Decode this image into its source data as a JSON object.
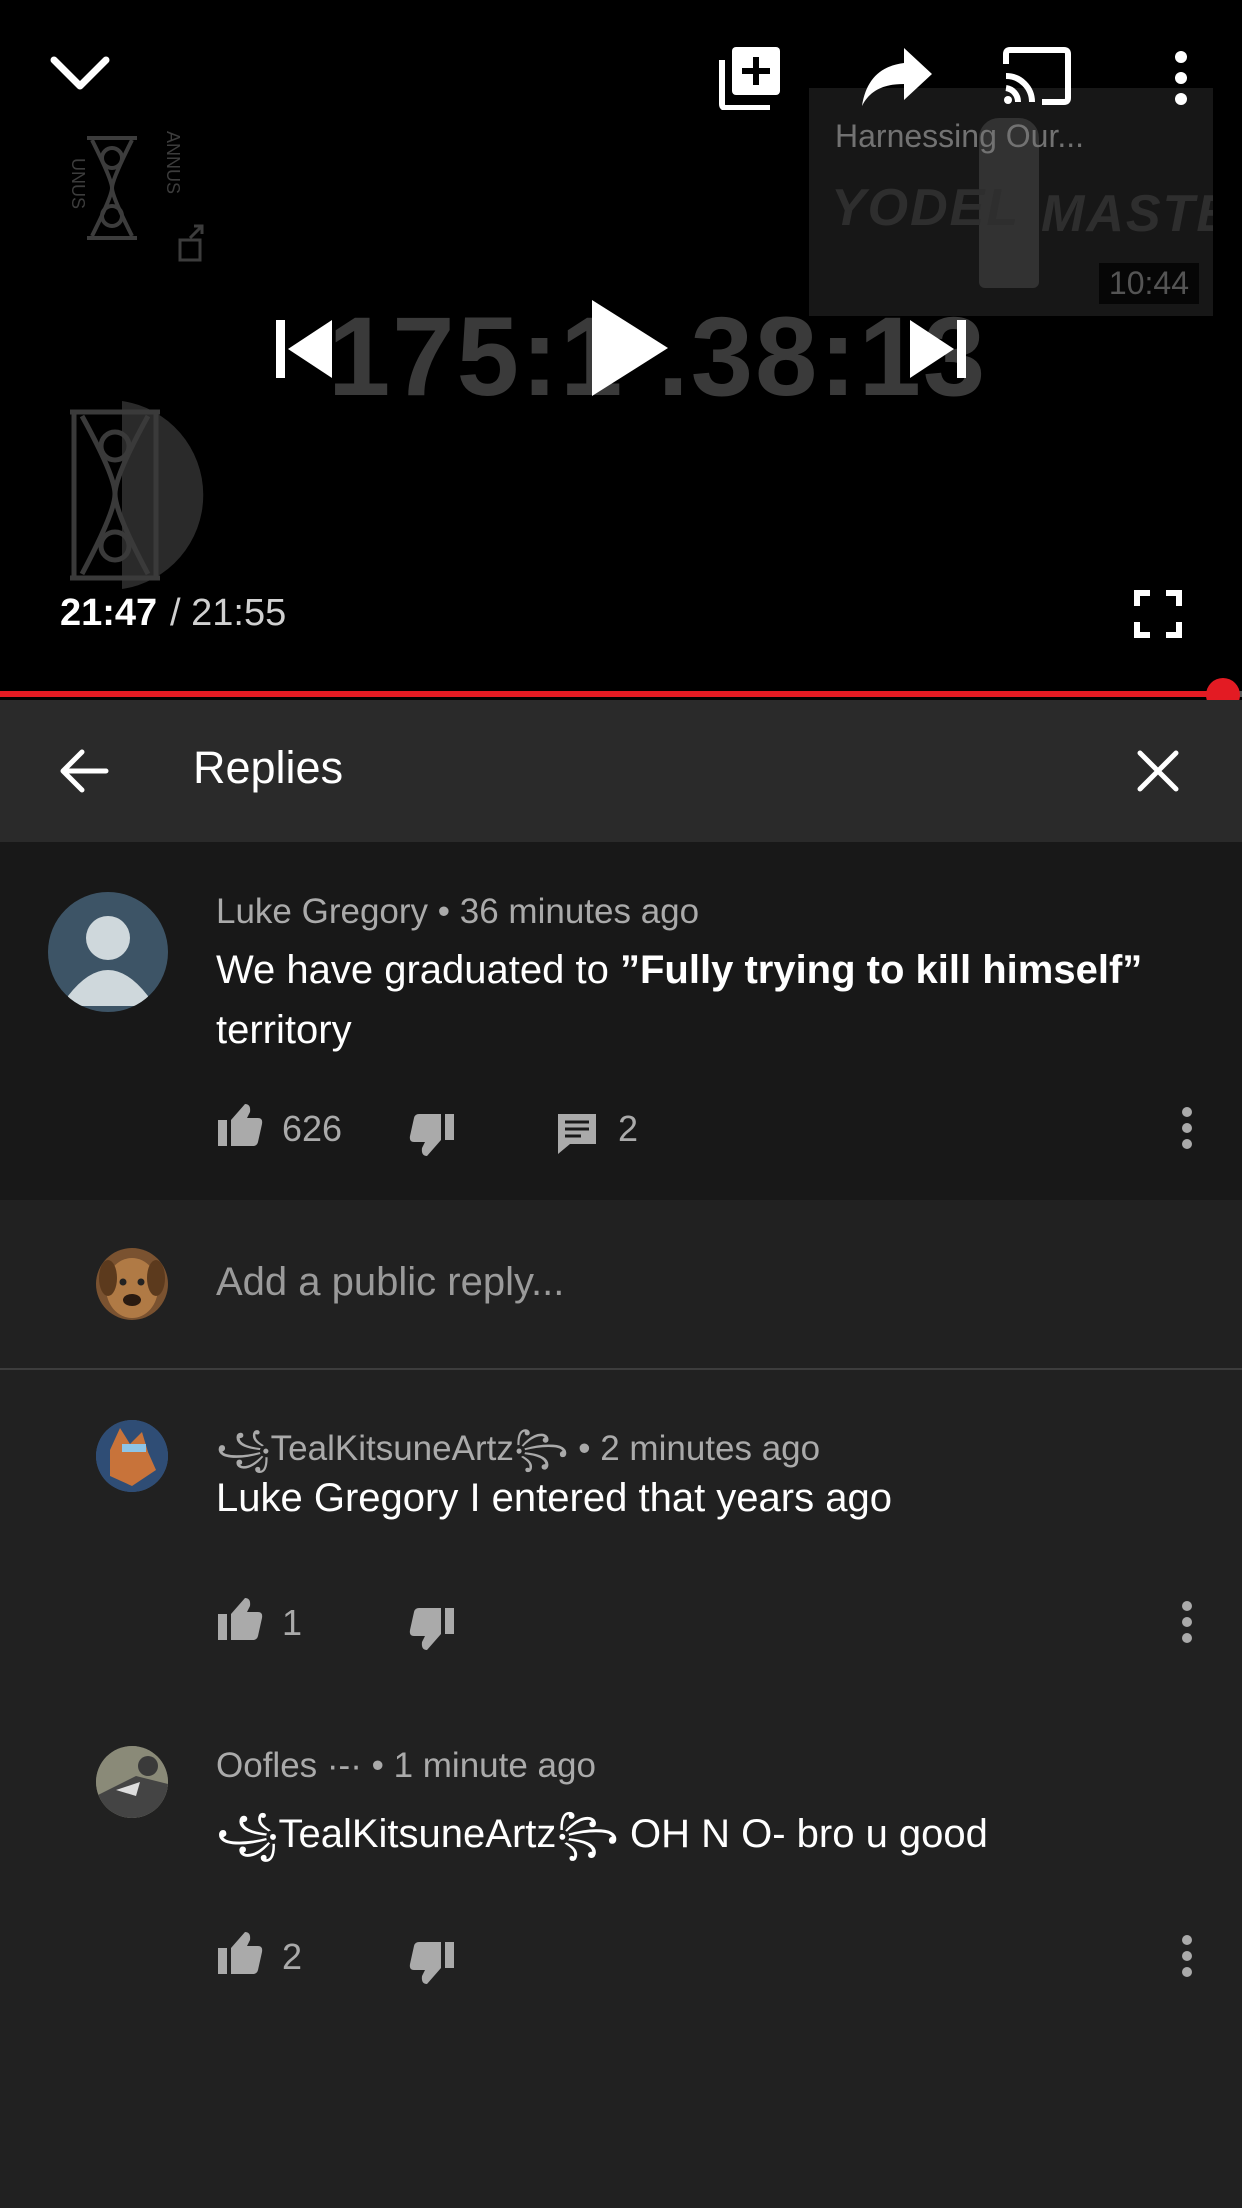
{
  "player": {
    "end_card": {
      "title": "Harnessing Our...",
      "word1": "YODEL",
      "word2": "MASTER",
      "duration": "10:44"
    },
    "big_time": "175:1 .38:13",
    "time_current": "21:47",
    "time_total": "/ 21:55",
    "progress_fraction": 0.994
  },
  "replies_panel": {
    "title": "Replies"
  },
  "parent_comment": {
    "author": "Luke Gregory",
    "age": "• 36 minutes ago",
    "text_prefix": "We have graduated to ",
    "text_bold": "”Fully trying to kill himself”",
    "text_suffix": "territory",
    "likes": "626",
    "reply_count": "2"
  },
  "reply_input": {
    "placeholder": "Add a public reply..."
  },
  "replies": [
    {
      "author": "꧁TealKitsuneArtz꧂",
      "age": "• 2 minutes ago",
      "text": "Luke Gregory I entered that years ago",
      "likes": "1"
    },
    {
      "author": "Oofles ·-·",
      "age": "• 1 minute ago",
      "text": "꧁TealKitsuneArtz꧂ OH N O- bro u good",
      "likes": "2"
    }
  ],
  "colors": {
    "accent": "#e31b23",
    "panel": "#212121",
    "parent_bg": "#181818",
    "header_bg": "#2a2a2a"
  }
}
